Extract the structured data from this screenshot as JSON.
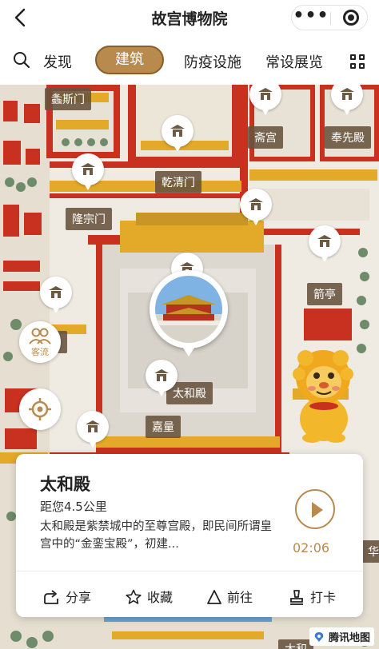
{
  "header": {
    "title": "故宫博物院"
  },
  "tabs": {
    "items": [
      {
        "label": "发现"
      },
      {
        "label": "建筑"
      },
      {
        "label": "防疫设施"
      },
      {
        "label": "常设展览"
      }
    ]
  },
  "map": {
    "labels": {
      "l1": "螽斯门",
      "l2": "斋宫",
      "l3": "奉先殿",
      "l4": "乾清门",
      "l5": "隆宗门",
      "l6": "箭亭",
      "l7": "太和殿",
      "l8": "嘉量",
      "l9": "太和",
      "l10": "华殿",
      "l11": "殿"
    },
    "crowd_label": "客流"
  },
  "card": {
    "title": "太和殿",
    "distance": "距您4.5公里",
    "description": "太和殿是紫禁城中的至尊宫殿，即民间所谓皇宫中的“金銮宝殿”，初建...",
    "duration": "02:06",
    "actions": {
      "share": "分享",
      "favorite": "收藏",
      "go": "前往",
      "checkin": "打卡"
    }
  },
  "watermark": "腾讯地图",
  "colors": {
    "accent": "#b98a4e",
    "wall": "#c8311f",
    "roof": "#e3a928"
  }
}
